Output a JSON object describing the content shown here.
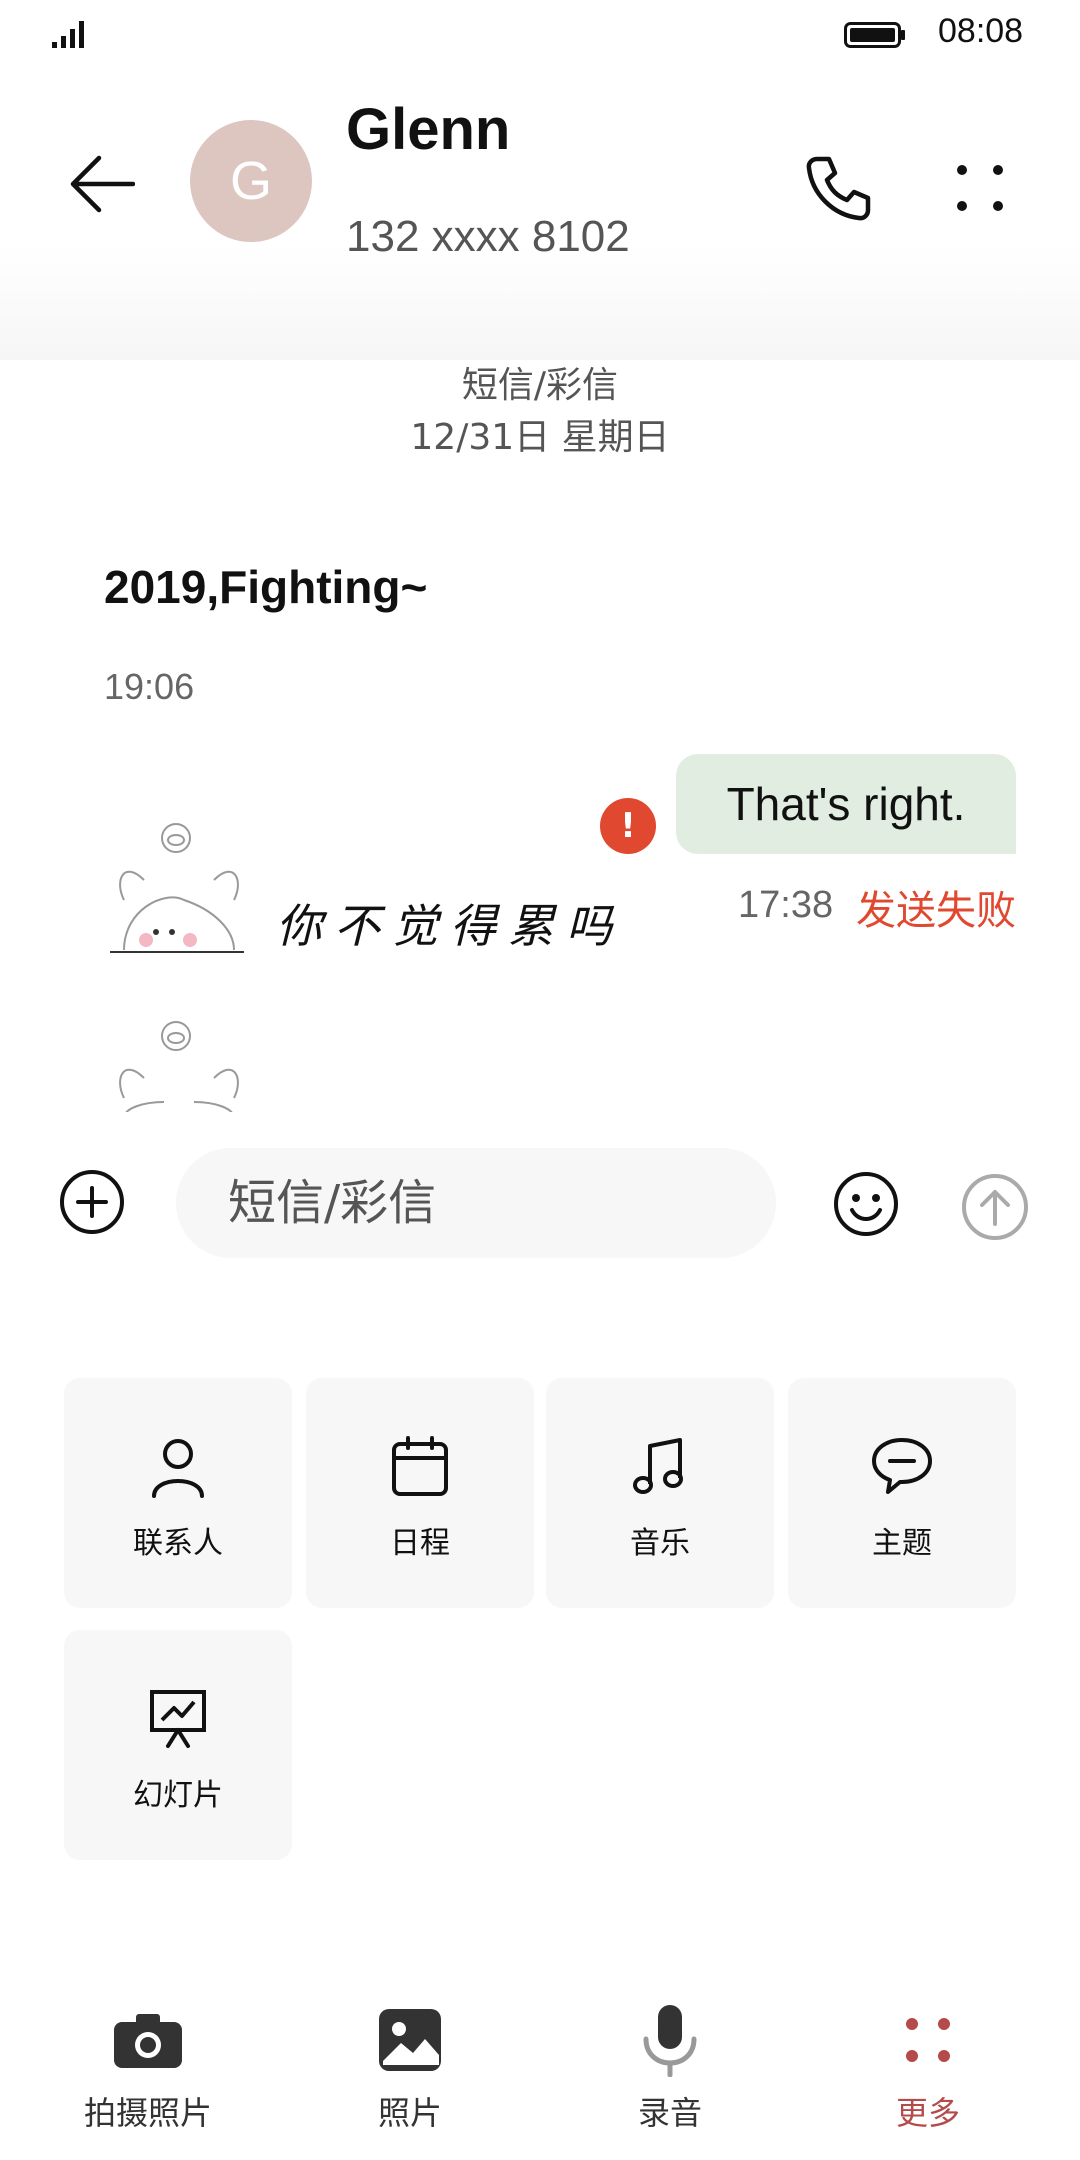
{
  "status_bar": {
    "time": "08:08"
  },
  "header": {
    "avatar_letter": "G",
    "contact_name": "Glenn",
    "contact_number": "132 xxxx 8102"
  },
  "conversation": {
    "thread_type": "短信/彩信",
    "thread_date": "12/31日 星期日",
    "messages": [
      {
        "direction": "incoming",
        "text": "2019,Fighting~",
        "time": "19:06"
      },
      {
        "direction": "incoming",
        "sticker_text": "你不觉得累吗"
      },
      {
        "direction": "outgoing",
        "text": "That's right.",
        "time": "17:38",
        "status": "发送失败",
        "error_badge": "!"
      }
    ]
  },
  "composer": {
    "placeholder": "短信/彩信"
  },
  "attachments": [
    {
      "label": "联系人",
      "icon": "contact-person-icon"
    },
    {
      "label": "日程",
      "icon": "calendar-icon"
    },
    {
      "label": "音乐",
      "icon": "music-note-icon"
    },
    {
      "label": "主题",
      "icon": "chat-bubble-icon"
    },
    {
      "label": "幻灯片",
      "icon": "slideshow-icon"
    }
  ],
  "bottom_bar": [
    {
      "label": "拍摄照片",
      "icon": "camera-icon"
    },
    {
      "label": "照片",
      "icon": "photo-icon"
    },
    {
      "label": "录音",
      "icon": "microphone-icon"
    },
    {
      "label": "更多",
      "icon": "more-dots-icon",
      "active": true
    }
  ],
  "colors": {
    "accent": "#b54a4a",
    "error": "#e0482f",
    "sent_bubble": "#e1ede0",
    "avatar": "#dcc6bf"
  }
}
